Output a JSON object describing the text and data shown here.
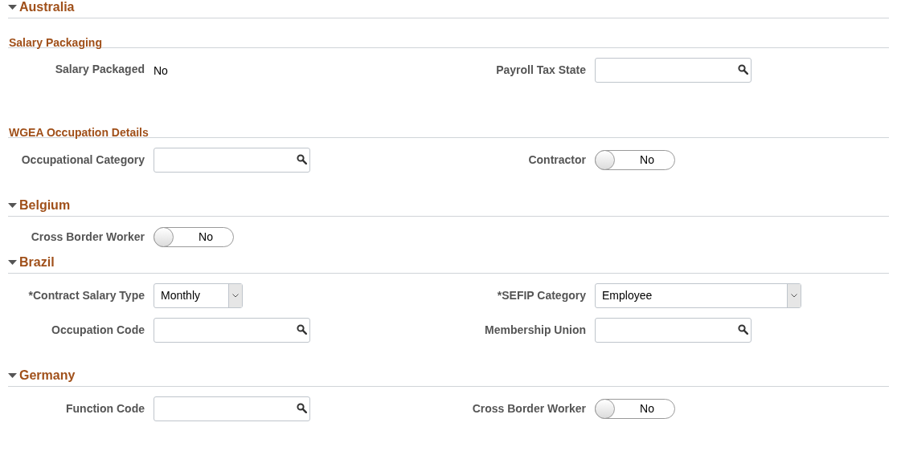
{
  "sections": [
    {
      "title": "Australia",
      "expanded": true,
      "groups": [
        {
          "title": "Salary Packaging",
          "rows": [
            [
              {
                "kind": "text",
                "label": "Salary Packaged",
                "value": "No"
              },
              {
                "kind": "lookup",
                "label": "Payroll Tax State"
              }
            ]
          ]
        },
        {
          "title": "WGEA Occupation Details",
          "rows": [
            [
              {
                "kind": "lookup",
                "label": "Occupational Category"
              },
              {
                "kind": "toggle",
                "label": "Contractor",
                "on": false,
                "value": "No"
              }
            ]
          ]
        }
      ]
    },
    {
      "title": "Belgium",
      "expanded": true,
      "groups": [
        {
          "rows": [
            [
              {
                "kind": "toggle",
                "label": "Cross Border Worker",
                "on": false,
                "value": "No"
              }
            ]
          ]
        }
      ]
    },
    {
      "title": "Brazil",
      "expanded": true,
      "groups": [
        {
          "rows": [
            [
              {
                "kind": "select",
                "label": "*Contract Salary Type",
                "value": "Monthly"
              },
              {
                "kind": "select",
                "label": "*SEFIP Category",
                "value": "Employee"
              }
            ],
            [
              {
                "kind": "lookup",
                "label": "Occupation Code"
              },
              {
                "kind": "lookup",
                "label": "Membership Union"
              }
            ]
          ]
        }
      ]
    },
    {
      "title": "Germany",
      "expanded": true,
      "groups": [
        {
          "rows": [
            [
              {
                "kind": "lookup",
                "label": "Function Code"
              },
              {
                "kind": "toggle",
                "label": "Cross Border Worker",
                "on": false,
                "value": "No"
              }
            ]
          ]
        }
      ]
    }
  ]
}
